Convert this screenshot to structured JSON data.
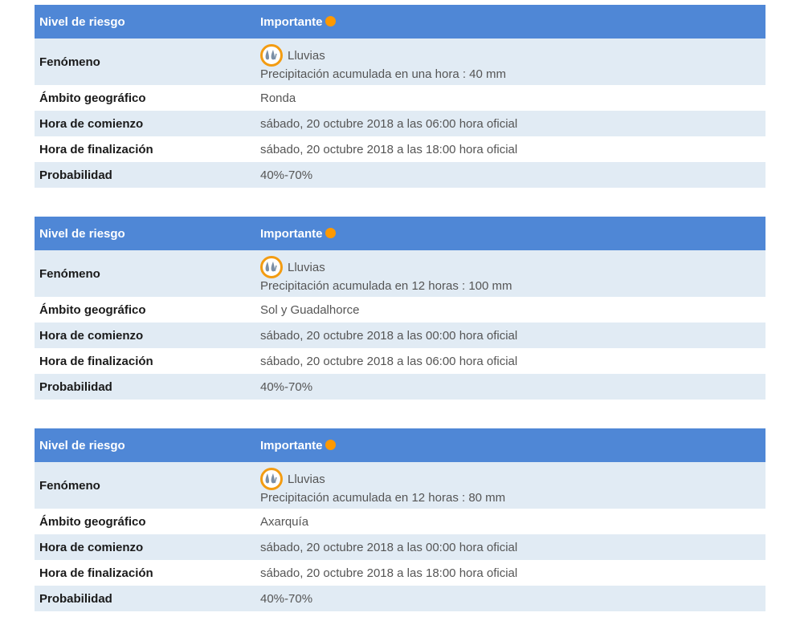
{
  "labels": {
    "nivel": "Nivel de riesgo",
    "fenomeno": "Fenómeno",
    "ambito": "Ámbito geográfico",
    "comienzo": "Hora de comienzo",
    "finalizacion": "Hora de finalización",
    "probabilidad": "Probabilidad"
  },
  "colors": {
    "header_bg": "#4f87d6",
    "row_alt_bg": "#e1ebf4",
    "risk_orange": "#ff9900",
    "icon_ring": "#f39c12"
  },
  "warnings": [
    {
      "nivel": "Importante",
      "fenomeno": "Lluvias",
      "detalle": "Precipitación acumulada en una hora : 40 mm",
      "ambito": "Ronda",
      "comienzo": "sábado, 20 octubre 2018 a las 06:00 hora oficial",
      "finalizacion": "sábado, 20 octubre 2018 a las 18:00 hora oficial",
      "probabilidad": "40%-70%"
    },
    {
      "nivel": "Importante",
      "fenomeno": "Lluvias",
      "detalle": "Precipitación acumulada en 12 horas : 100 mm",
      "ambito": "Sol y Guadalhorce",
      "comienzo": "sábado, 20 octubre 2018 a las 00:00 hora oficial",
      "finalizacion": "sábado, 20 octubre 2018 a las 06:00 hora oficial",
      "probabilidad": "40%-70%"
    },
    {
      "nivel": "Importante",
      "fenomeno": "Lluvias",
      "detalle": "Precipitación acumulada en 12 horas : 80 mm",
      "ambito": "Axarquía",
      "comienzo": "sábado, 20 octubre 2018 a las 00:00 hora oficial",
      "finalizacion": "sábado, 20 octubre 2018 a las 18:00 hora oficial",
      "probabilidad": "40%-70%"
    }
  ]
}
